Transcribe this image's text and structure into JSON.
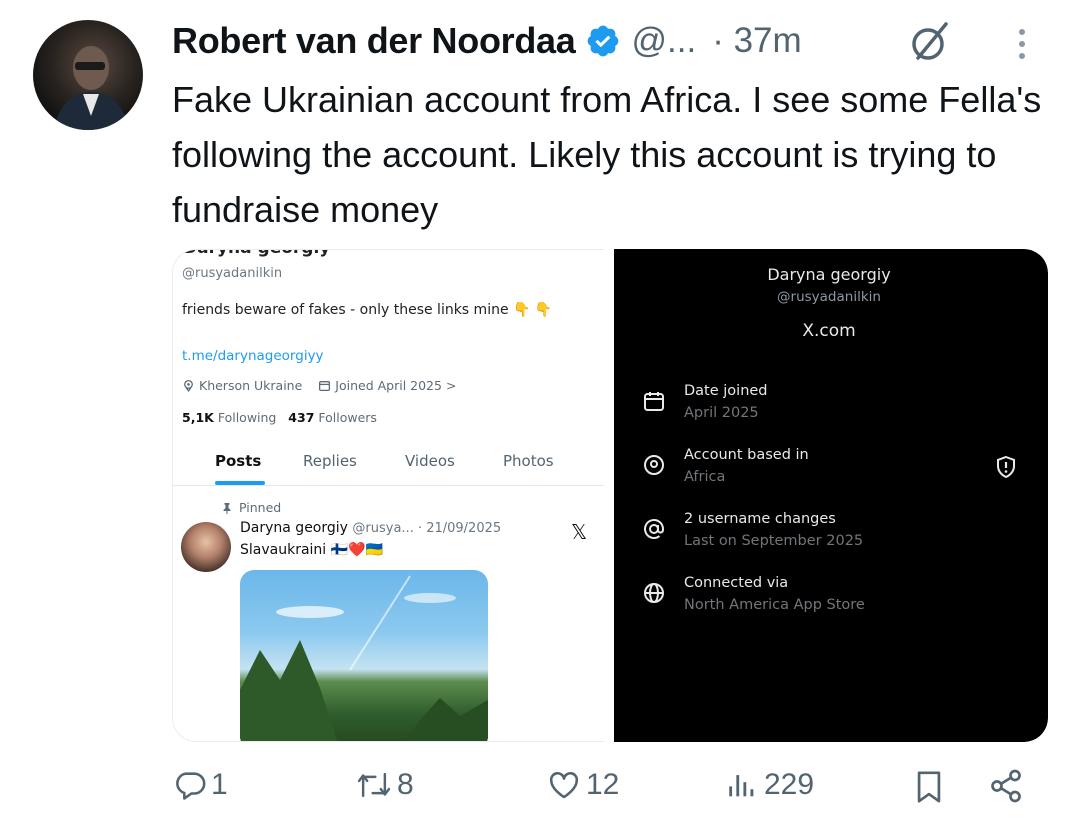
{
  "tweet": {
    "author_name": "Robert van der Noordaa",
    "handle": "@...",
    "separator": "·",
    "time": "37m",
    "text": "Fake Ukrainian account from Africa. I see some Fella's following the account. Likely this account is trying to fundraise money"
  },
  "media_left": {
    "profile_name": "Daryna georgiy",
    "handle": "@rusyadanilkin",
    "bio": "friends beware of fakes - only these links mine",
    "bio_emoji": "👇 👇",
    "link": "t.me/darynageorgiyy",
    "location": "Kherson Ukraine",
    "joined": "Joined April 2025 >",
    "following_count": "5,1K",
    "following_label": "Following",
    "followers_count": "437",
    "followers_label": "Followers",
    "tabs": [
      "Posts",
      "Replies",
      "Videos",
      "Photos"
    ],
    "pinned_label": "Pinned",
    "post_author": "Daryna georgiy",
    "post_meta": "@rusya... · 21/09/2025",
    "post_text": "Slavaukraini",
    "post_flags": "🇫🇮❤️🇺🇦"
  },
  "media_right": {
    "name": "Daryna georgiy",
    "handle": "@rusyadanilkin",
    "site": "X.com",
    "rows": [
      {
        "title": "Date joined",
        "sub": "April 2025",
        "icon": "calendar-icon"
      },
      {
        "title": "Account based in",
        "sub": "Africa",
        "icon": "location-icon"
      },
      {
        "title": "2 username changes",
        "sub": "Last on September 2025",
        "icon": "at-icon"
      },
      {
        "title": "Connected via",
        "sub": "North America App Store",
        "icon": "globe-icon"
      }
    ]
  },
  "actions": {
    "replies": "1",
    "reposts": "8",
    "likes": "12",
    "views": "229"
  },
  "colors": {
    "text": "#0f1419",
    "muted": "#536471",
    "verified": "#1d9bf0",
    "link": "#1d9bf0"
  }
}
